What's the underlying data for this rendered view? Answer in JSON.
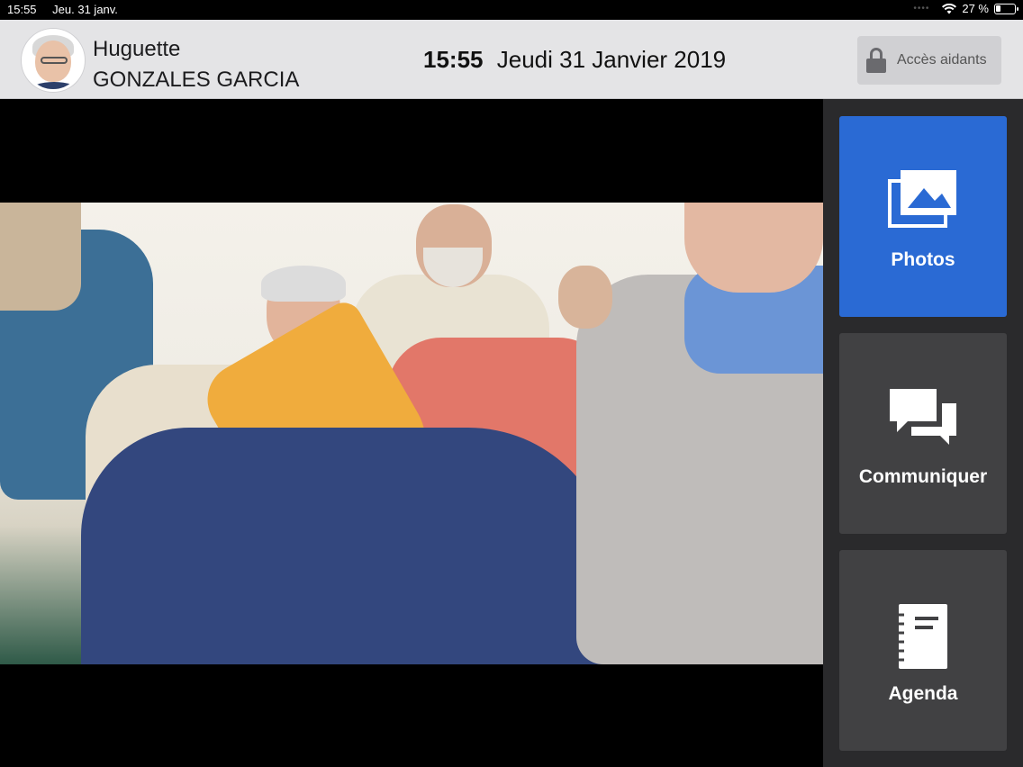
{
  "status_bar": {
    "time": "15:55",
    "date": "Jeu. 31 janv.",
    "battery": "27 %",
    "battery_level": 0.27
  },
  "header": {
    "first_name": "Huguette",
    "last_name": "GONZALES GARCIA",
    "time": "15:55",
    "date": "Jeudi 31 Janvier 2019",
    "access_label": "Accès aidants"
  },
  "sidebar": {
    "items": [
      {
        "label": "Photos",
        "icon": "photos-icon",
        "active": true
      },
      {
        "label": "Communiquer",
        "icon": "chat-icon",
        "active": false
      },
      {
        "label": "Agenda",
        "icon": "notebook-icon",
        "active": false
      }
    ]
  },
  "colors": {
    "accent": "#2a6ad4",
    "tile": "#414143",
    "sidebar": "#2a2a2c",
    "header": "#e4e4e6"
  }
}
